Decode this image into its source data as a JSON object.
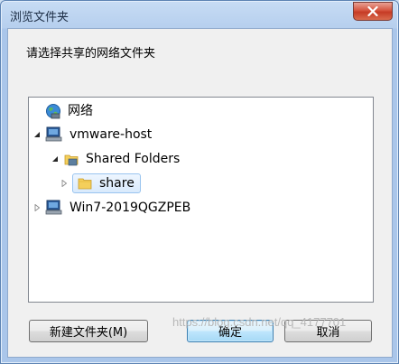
{
  "window": {
    "title": "浏览文件夹",
    "close_icon": "close-icon"
  },
  "dialog": {
    "instruction": "请选择共享的网络文件夹"
  },
  "tree": {
    "items": [
      {
        "label": "网络",
        "icon": "network-globe-icon",
        "expander": "none"
      },
      {
        "label": "vmware-host",
        "icon": "computer-icon",
        "expander": "expanded"
      },
      {
        "label": "Shared Folders",
        "icon": "shared-folder-icon",
        "expander": "expanded"
      },
      {
        "label": "share",
        "icon": "folder-icon",
        "expander": "collapsed",
        "selected": true
      },
      {
        "label": "Win7-2019QGZPEB",
        "icon": "computer-icon",
        "expander": "collapsed"
      }
    ]
  },
  "buttons": {
    "new_folder": "新建文件夹(M)",
    "ok": "确定",
    "cancel": "取消"
  },
  "watermark": "https://blog.csdn.net/qq_4177701"
}
